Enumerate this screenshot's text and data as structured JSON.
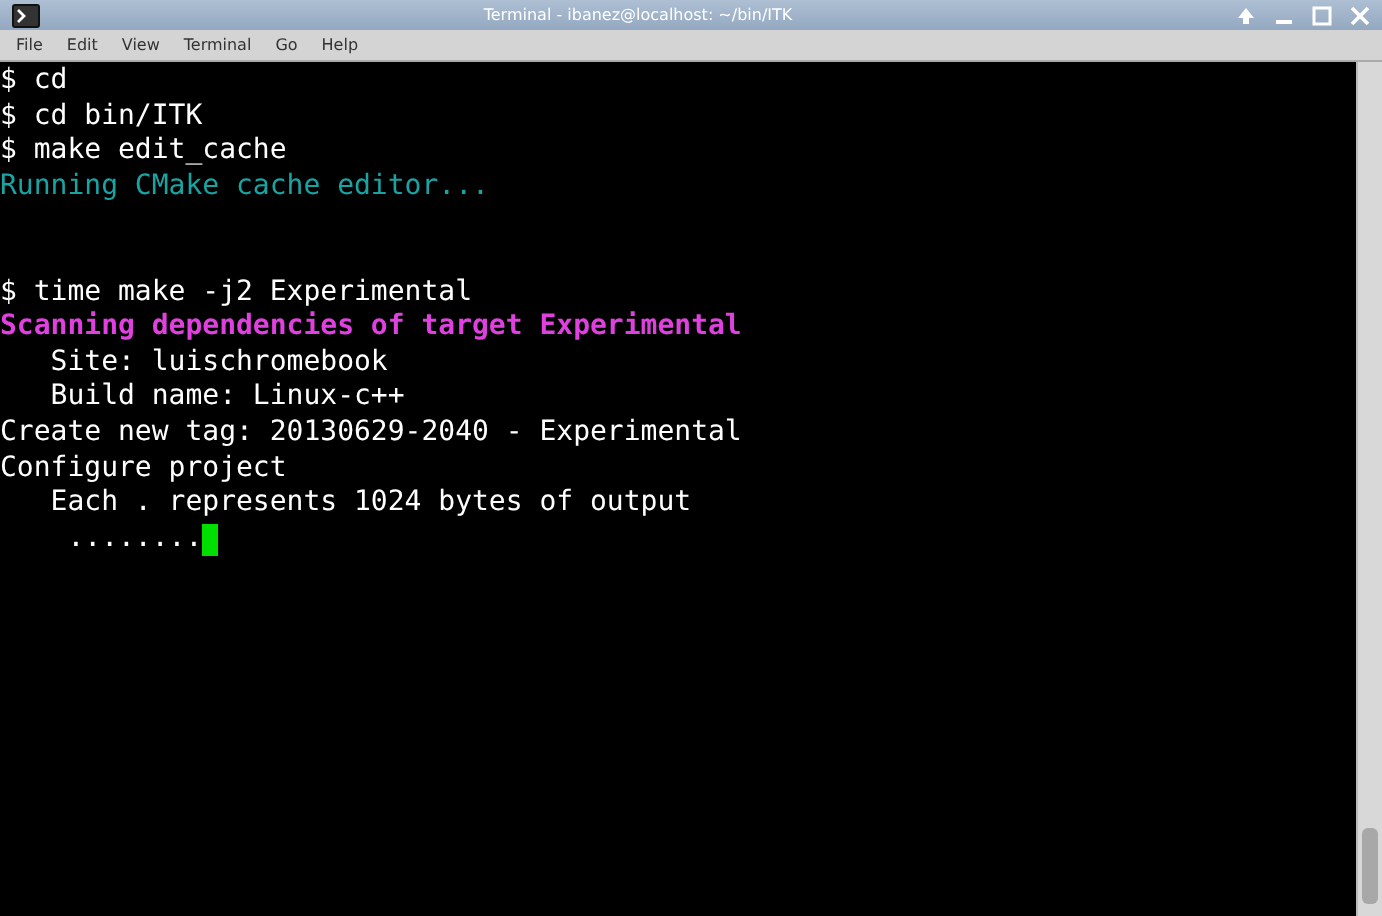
{
  "window": {
    "title": "Terminal - ibanez@localhost: ~/bin/ITK"
  },
  "menu": [
    "File",
    "Edit",
    "View",
    "Terminal",
    "Go",
    "Help"
  ],
  "terminal": {
    "lines": [
      {
        "kind": "output",
        "text": "$ cd"
      },
      {
        "kind": "output",
        "text": "$ cd bin/ITK"
      },
      {
        "kind": "output",
        "text": "$ make edit_cache"
      },
      {
        "kind": "info",
        "text": "Running CMake cache editor..."
      },
      {
        "kind": "blank"
      },
      {
        "kind": "blank"
      },
      {
        "kind": "output",
        "text": "$ time make -j2 Experimental"
      },
      {
        "kind": "highlight",
        "text": "Scanning dependencies of target Experimental"
      },
      {
        "kind": "output",
        "text": "   Site: luischromebook"
      },
      {
        "kind": "output",
        "text": "   Build name: Linux-c++"
      },
      {
        "kind": "output",
        "text": "Create new tag: 20130629-2040 - Experimental"
      },
      {
        "kind": "output",
        "text": "Configure project"
      },
      {
        "kind": "output",
        "text": "   Each . represents 1024 bytes of output"
      },
      {
        "kind": "output",
        "text": "    ........",
        "cursor": true
      }
    ]
  }
}
